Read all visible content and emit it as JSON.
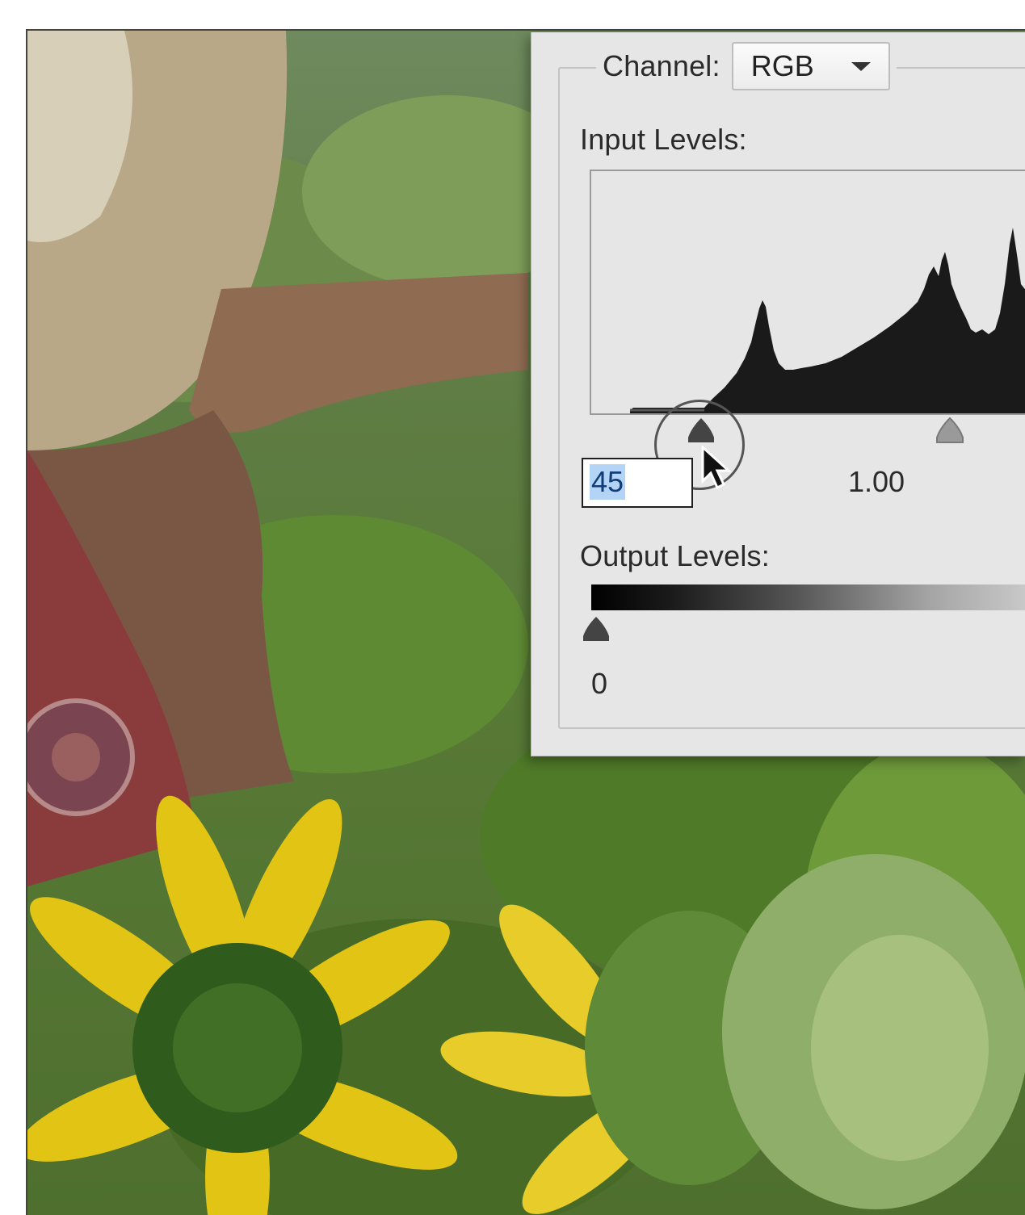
{
  "dialog": {
    "channel_label": "Channel:",
    "channel_value": "RGB",
    "input_levels_label": "Input Levels:",
    "input_black_value": "45",
    "input_gamma_value": "1.00",
    "output_levels_label": "Output Levels:",
    "output_black_value": "0"
  },
  "icons": {
    "channel_dropdown": "chevron-down-icon",
    "cursor": "arrow-cursor-icon"
  },
  "colors": {
    "dialog_bg": "#e6e6e6",
    "histogram_fill": "#1a1a1a",
    "selection_highlight": "#b3d4f5"
  }
}
